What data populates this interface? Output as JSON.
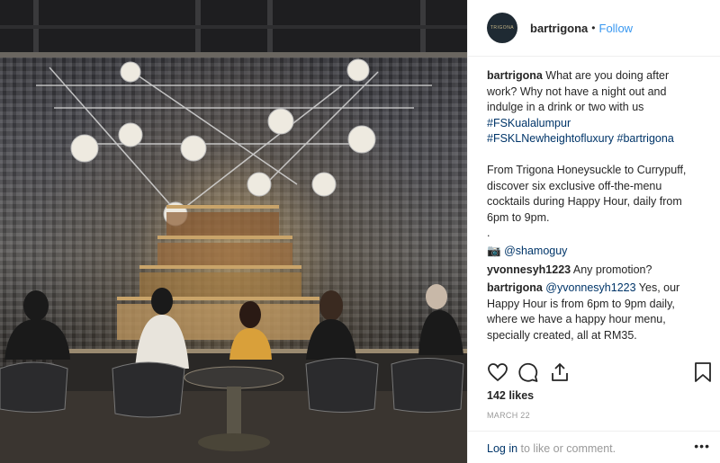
{
  "post": {
    "username": "bartrigona",
    "avatar_text": "TRIGONA",
    "follow_label": "Follow",
    "separator": "•"
  },
  "caption": {
    "username": "bartrigona",
    "text1": " What are you doing after work? Why not have a night out and indulge in a drink or two with us ",
    "tag1": "#FSKualalumpur",
    "tag2": "#FSKLNewheightofluxury",
    "tag3": "#bartrigona",
    "text2": "From Trigona Honeysuckle to Currypuff, discover six exclusive off-the-menu cocktails during Happy Hour, daily from 6pm to 9pm.",
    "text3": ".",
    "camera_icon": "📷",
    "mention": "@shamoguy"
  },
  "comments": [
    {
      "username": "yvonnesyh1223",
      "text": " Any promotion?"
    },
    {
      "username": "bartrigona",
      "mention": "@yvonnesyh1223",
      "text": " Yes, our Happy Hour is from 6pm to 9pm daily, where we have a happy hour menu, specially created, all at RM35."
    }
  ],
  "actions": {
    "icons": [
      "heart-icon",
      "comment-icon",
      "share-icon",
      "bookmark-icon"
    ]
  },
  "likes_text": "142 likes",
  "date_text": "MARCH 22",
  "footer": {
    "login_link": "Log in",
    "login_text": " to like or comment.",
    "more_icon": "•••"
  },
  "colors": {
    "link": "#003569",
    "follow": "#3897f0",
    "muted": "#999999",
    "text": "#262626"
  }
}
